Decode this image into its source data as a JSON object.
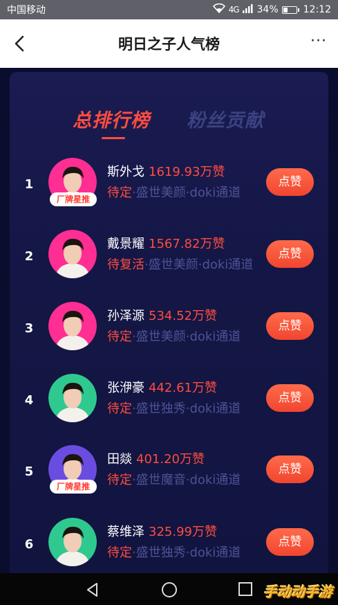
{
  "status_bar": {
    "carrier": "中国移动",
    "signal": "4G",
    "battery": "34%",
    "battery_level": 0.34,
    "time": "12:12"
  },
  "header": {
    "title": "明日之子人气榜",
    "more": "···"
  },
  "tabs": [
    {
      "label": "总排行榜",
      "active": true
    },
    {
      "label": "粉丝贡献",
      "active": false
    }
  ],
  "ranking": [
    {
      "rank": "1",
      "name": "斯外戈",
      "likes": "1619.93万赞",
      "status": "待定",
      "group": "·盛世美颜·doki通道",
      "badge": "厂牌星推",
      "button": "点赞",
      "avatar_bg": "#ff2e93"
    },
    {
      "rank": "2",
      "name": "戴景耀",
      "likes": "1567.82万赞",
      "status": "待复活",
      "group": "·盛世美颜·doki通道",
      "badge": "",
      "button": "点赞",
      "avatar_bg": "#ff2e93"
    },
    {
      "rank": "3",
      "name": "孙泽源",
      "likes": "534.52万赞",
      "status": "待定",
      "group": "·盛世美颜·doki通道",
      "badge": "",
      "button": "点赞",
      "avatar_bg": "#ff2e93"
    },
    {
      "rank": "4",
      "name": "张洢豪",
      "likes": "442.61万赞",
      "status": "待定",
      "group": "·盛世独秀·doki通道",
      "badge": "",
      "button": "点赞",
      "avatar_bg": "#2fc98f"
    },
    {
      "rank": "5",
      "name": "田燚",
      "likes": "401.20万赞",
      "status": "待定",
      "group": "·盛世魔音·doki通道",
      "badge": "厂牌星推",
      "button": "点赞",
      "avatar_bg": "#6a4de0"
    },
    {
      "rank": "6",
      "name": "蔡维泽",
      "likes": "325.99万赞",
      "status": "待定",
      "group": "·盛世独秀·doki通道",
      "badge": "",
      "button": "点赞",
      "avatar_bg": "#2fc98f"
    }
  ],
  "watermark": "手动动手游",
  "colors": {
    "accent": "#ff4d3f",
    "background": "#0d0f3a",
    "inactive_tab": "#3c4280",
    "group_text": "#4d5294"
  }
}
